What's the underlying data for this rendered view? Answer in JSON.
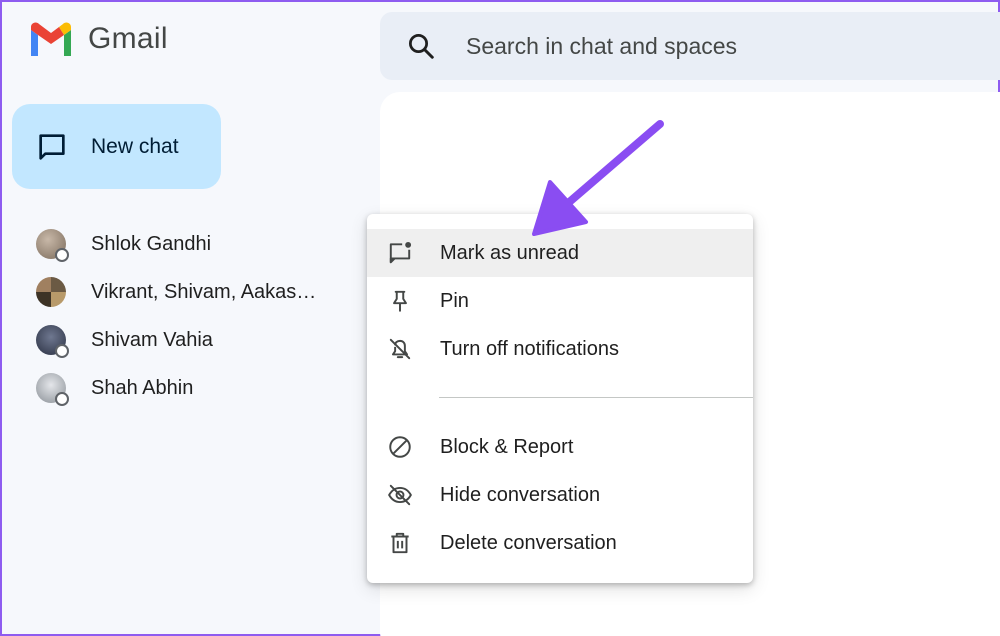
{
  "app": {
    "title": "Gmail"
  },
  "search": {
    "placeholder": "Search in chat and spaces"
  },
  "new_chat": {
    "label": "New chat"
  },
  "chats": [
    {
      "name": "Shlok Gandhi",
      "avatar_color": "#8a7a6c"
    },
    {
      "name": "Vikrant, Shivam, Aakas…",
      "avatar_color": "#6b5a44"
    },
    {
      "name": "Shivam Vahia",
      "avatar_color": "#3a4256"
    },
    {
      "name": "Shah Abhin",
      "avatar_color": "#9aa0a6"
    }
  ],
  "menu": {
    "group1": [
      {
        "label": "Mark as unread",
        "icon": "mark-unread-icon",
        "highlighted": true
      },
      {
        "label": "Pin",
        "icon": "pin-icon"
      },
      {
        "label": "Turn off notifications",
        "icon": "notifications-off-icon"
      }
    ],
    "group2": [
      {
        "label": "Block & Report",
        "icon": "block-icon"
      },
      {
        "label": "Hide conversation",
        "icon": "hide-icon"
      },
      {
        "label": "Delete conversation",
        "icon": "trash-icon"
      }
    ]
  },
  "colors": {
    "accent": "#c2e7ff",
    "annotation_arrow": "#8a4df2",
    "frame_border": "#8e5cf0"
  }
}
